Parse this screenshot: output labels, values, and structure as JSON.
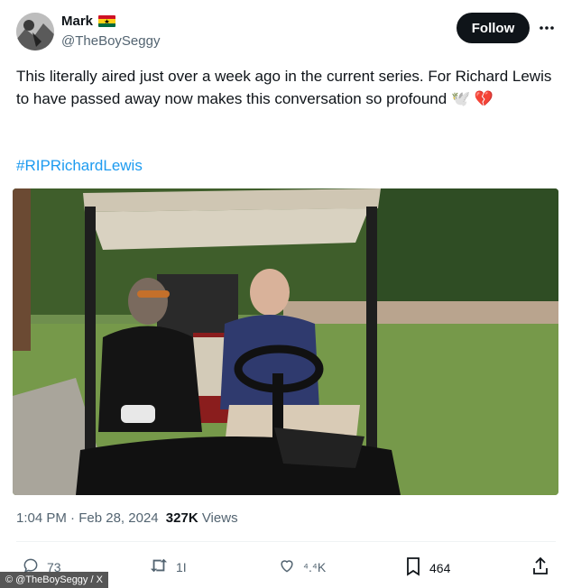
{
  "user": {
    "name": "Mark",
    "handle": "@TheBoySeggy",
    "flag_colors": [
      "#ce1126",
      "#fcd116",
      "#006b3f"
    ],
    "follow_label": "Follow"
  },
  "tweet": {
    "text": "This literally aired just over a week ago in the current series. For Richard Lewis to have passed away now makes this conversation so profound 🕊️ 💔",
    "hashtag": "#RIPRichardLewis"
  },
  "meta": {
    "time": "1:04 PM",
    "separator": " · ",
    "date": "Feb 28, 2024",
    "views_count": "327K",
    "views_label": " Views"
  },
  "actions": {
    "replies": "73",
    "reposts": "1I",
    "likes": "⁴.⁴K",
    "bookmarks": "464"
  },
  "credit": "© @TheBoySeggy / X",
  "colors": {
    "link": "#1d9bf0",
    "secondary_text": "#536471",
    "follow_bg": "#0f1419"
  }
}
